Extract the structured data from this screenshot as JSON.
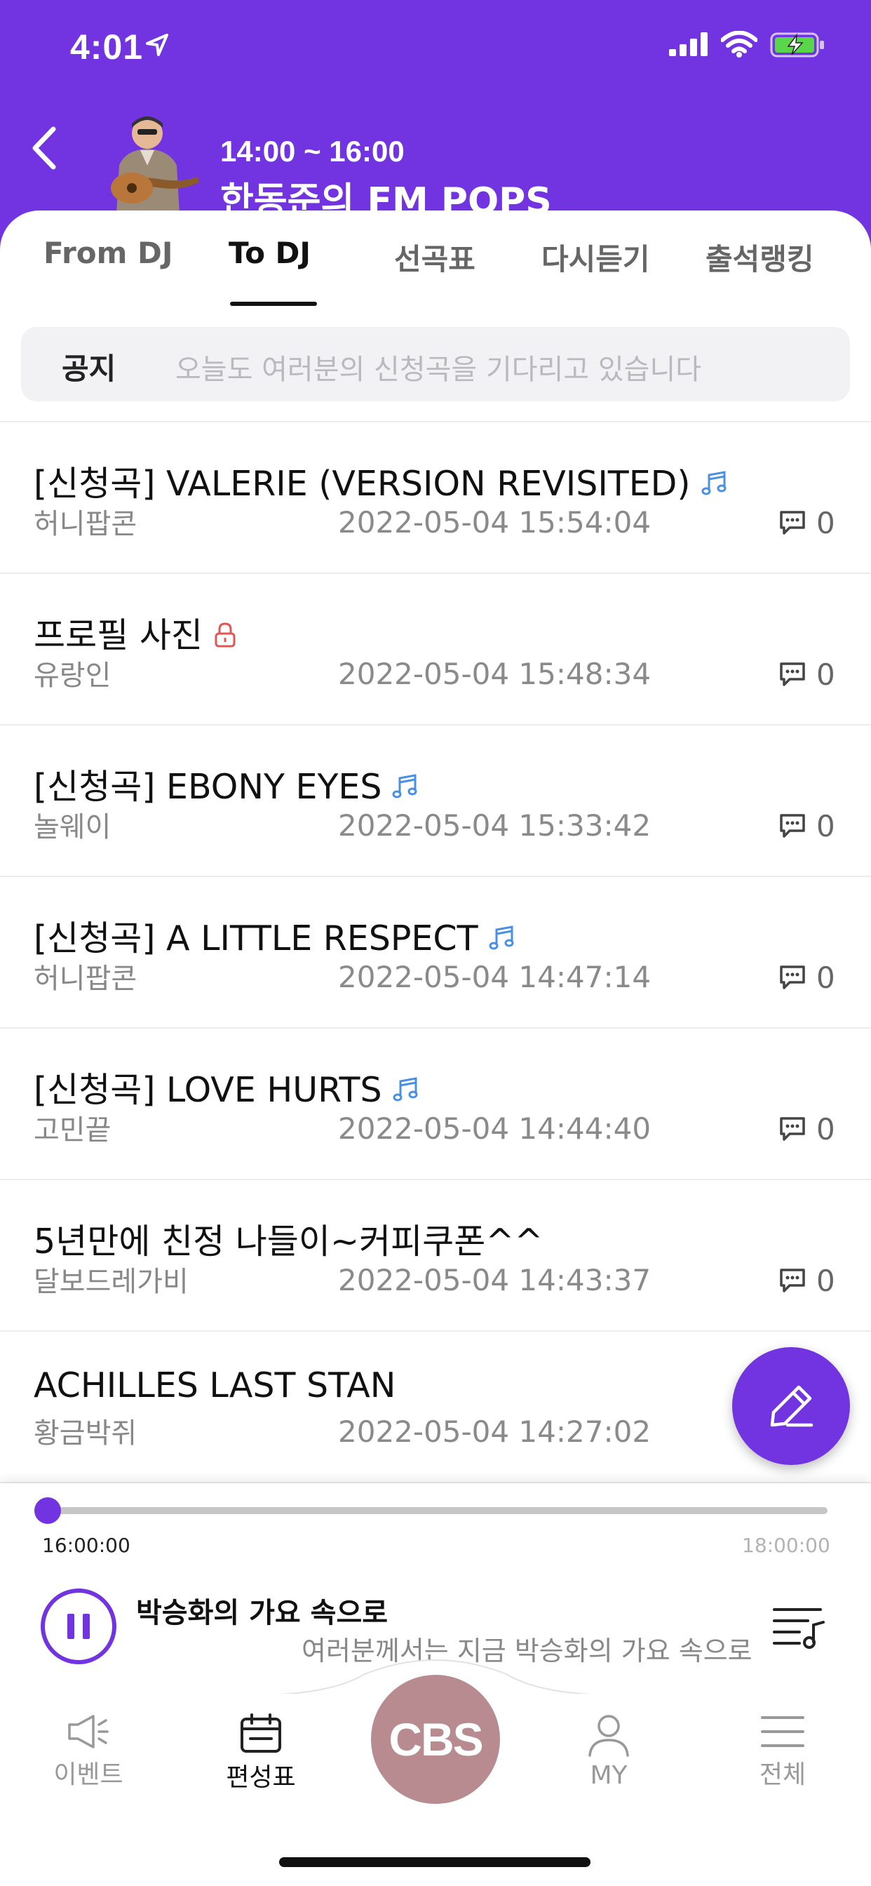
{
  "status_bar": {
    "time": "4:01"
  },
  "header": {
    "show_time": "14:00 ~ 16:00",
    "show_title": "한동준의 FM POPS"
  },
  "tabs": [
    {
      "label": "From DJ",
      "active": false
    },
    {
      "label": "To DJ",
      "active": true
    },
    {
      "label": "선곡표",
      "active": false
    },
    {
      "label": "다시듣기",
      "active": false
    },
    {
      "label": "출석랭킹",
      "active": false
    }
  ],
  "notice": {
    "label": "공지",
    "text": "오늘도 여러분의 신청곡을 기다리고 있습니다"
  },
  "posts": [
    {
      "title": "[신청곡] VALERIE (VERSION REVISITED)",
      "icon": "music-note-icon",
      "author": "허니팝콘",
      "date": "2022-05-04 15:54:04",
      "comments": "0"
    },
    {
      "title": "프로필  사진",
      "icon": "lock-icon",
      "author": "유랑인",
      "date": "2022-05-04 15:48:34",
      "comments": "0"
    },
    {
      "title": "[신청곡] EBONY EYES",
      "icon": "music-note-icon",
      "author": "놀웨이",
      "date": "2022-05-04 15:33:42",
      "comments": "0"
    },
    {
      "title": "[신청곡] A LITTLE RESPECT",
      "icon": "music-note-icon",
      "author": "허니팝콘",
      "date": "2022-05-04 14:47:14",
      "comments": "0"
    },
    {
      "title": "[신청곡] LOVE HURTS",
      "icon": "music-note-icon",
      "author": "고민끝",
      "date": "2022-05-04 14:44:40",
      "comments": "0"
    },
    {
      "title": "5년만에 친정 나들이~커피쿠폰^^",
      "icon": "",
      "author": "달보드레가비",
      "date": "2022-05-04 14:43:37",
      "comments": "0"
    },
    {
      "title": "ACHILLES LAST STAN",
      "icon": "",
      "author": "황금박쥐",
      "date": "2022-05-04 14:27:02",
      "comments": ""
    }
  ],
  "player": {
    "time_start": "16:00:00",
    "time_end": "18:00:00",
    "progress": 0.0,
    "now_title": "박승화의 가요 속으로",
    "now_sub": "여러분께서는 지금 박승화의 가요 속으로"
  },
  "nav": {
    "events": "이벤트",
    "schedule": "편성표",
    "center": "CBS",
    "my": "MY",
    "all": "전체"
  },
  "colors": {
    "accent": "#7234e0",
    "music_icon": "#4a90e2",
    "lock_icon": "#e05555",
    "cbs_button": "#b78b90"
  }
}
